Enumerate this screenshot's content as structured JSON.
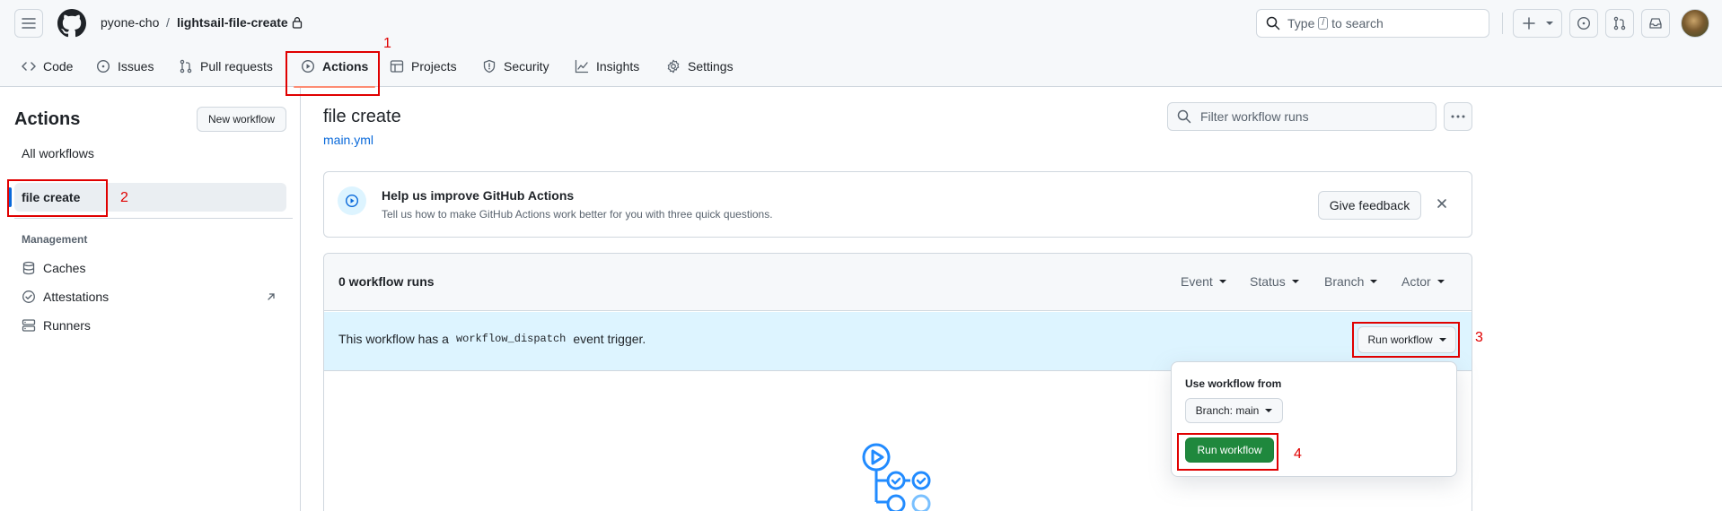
{
  "header": {
    "owner": "pyone-cho",
    "separator": "/",
    "repo": "lightsail-file-create",
    "search_prefix": "Type",
    "search_key": "/",
    "search_suffix": "to search"
  },
  "repo_nav": {
    "tabs": [
      {
        "label": "Code",
        "icon": "code-icon"
      },
      {
        "label": "Issues",
        "icon": "issue-icon"
      },
      {
        "label": "Pull requests",
        "icon": "pull-request-icon"
      },
      {
        "label": "Actions",
        "icon": "play-icon",
        "active": true
      },
      {
        "label": "Projects",
        "icon": "table-icon"
      },
      {
        "label": "Security",
        "icon": "shield-icon"
      },
      {
        "label": "Insights",
        "icon": "graph-icon"
      },
      {
        "label": "Settings",
        "icon": "gear-icon"
      }
    ]
  },
  "annotations": [
    "1",
    "2",
    "3",
    "4"
  ],
  "sidebar": {
    "title": "Actions",
    "new_workflow": "New workflow",
    "all_workflows": "All workflows",
    "selected_workflow": "file create",
    "management_heading": "Management",
    "management_items": [
      {
        "label": "Caches",
        "icon": "database-icon"
      },
      {
        "label": "Attestations",
        "icon": "verified-icon"
      },
      {
        "label": "Runners",
        "icon": "server-icon"
      }
    ]
  },
  "main": {
    "workflow_title": "file create",
    "workflow_file": "main.yml",
    "filter_placeholder": "Filter workflow runs",
    "feedback": {
      "title": "Help us improve GitHub Actions",
      "subtitle": "Tell us how to make GitHub Actions work better for you with three quick questions.",
      "button": "Give feedback"
    },
    "runs": {
      "count_label": "0 workflow runs",
      "filters": [
        "Event",
        "Status",
        "Branch",
        "Actor"
      ],
      "dispatch_prefix": "This workflow has a",
      "dispatch_code": "workflow_dispatch",
      "dispatch_suffix": "event trigger.",
      "run_workflow": "Run workflow"
    },
    "run_dropdown": {
      "heading": "Use workflow from",
      "branch_button": "Branch: main",
      "run_button": "Run workflow"
    }
  },
  "colors": {
    "accent_link": "#0969da",
    "annotation_red": "#e00000",
    "primary_green": "#1f883d",
    "dispatch_bg": "#ddf4ff",
    "tab_underline": "#fd8c73"
  }
}
